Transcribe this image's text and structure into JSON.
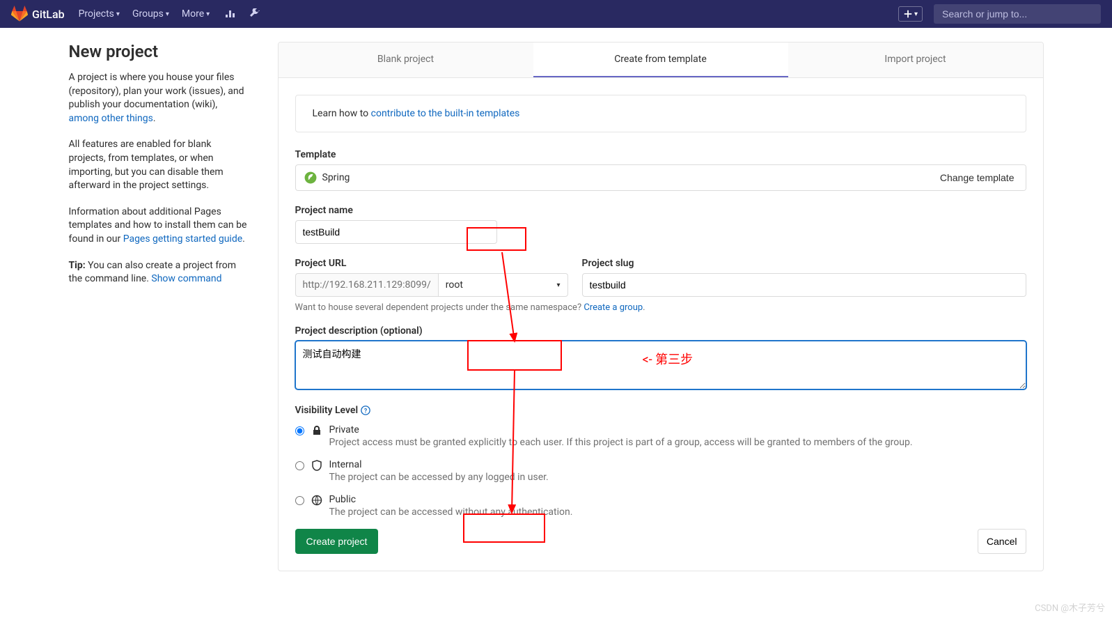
{
  "nav": {
    "logo_text": "GitLab",
    "items": [
      "Projects",
      "Groups",
      "More"
    ],
    "search_placeholder": "Search or jump to..."
  },
  "left": {
    "heading": "New project",
    "p1_a": "A project is where you house your files (repository), plan your work (issues), and publish your documentation (wiki), ",
    "p1_link": "among other things",
    "p2": "All features are enabled for blank projects, from templates, or when importing, but you can disable them afterward in the project settings.",
    "p3_a": "Information about additional Pages templates and how to install them can be found in our ",
    "p3_link": "Pages getting started guide",
    "p4_a": "Tip:",
    "p4_b": " You can also create a project from the command line. ",
    "p4_link": "Show command"
  },
  "tabs": {
    "blank": "Blank project",
    "template": "Create from template",
    "import": "Import project"
  },
  "callout": {
    "prefix": "Learn how to ",
    "link": "contribute to the built-in templates"
  },
  "template": {
    "label": "Template",
    "name": "Spring",
    "change": "Change template"
  },
  "name": {
    "label": "Project name",
    "value": "testBuild"
  },
  "url": {
    "label": "Project URL",
    "base": "http://192.168.211.129:8099/",
    "namespace": "root",
    "hint_a": "Want to house several dependent projects under the same namespace? ",
    "hint_link": "Create a group"
  },
  "slug": {
    "label": "Project slug",
    "value": "testbuild"
  },
  "desc": {
    "label": "Project description (optional)",
    "value": "测试自动构建"
  },
  "vis": {
    "label": "Visibility Level",
    "private_t": "Private",
    "private_d": "Project access must be granted explicitly to each user. If this project is part of a group, access will be granted to members of the group.",
    "internal_t": "Internal",
    "internal_d": "The project can be accessed by any logged in user.",
    "public_t": "Public",
    "public_d": "The project can be accessed without any authentication."
  },
  "actions": {
    "create": "Create project",
    "cancel": "Cancel"
  },
  "annot": {
    "step3": "<-  第三步"
  },
  "watermark": "CSDN @木子芳兮"
}
